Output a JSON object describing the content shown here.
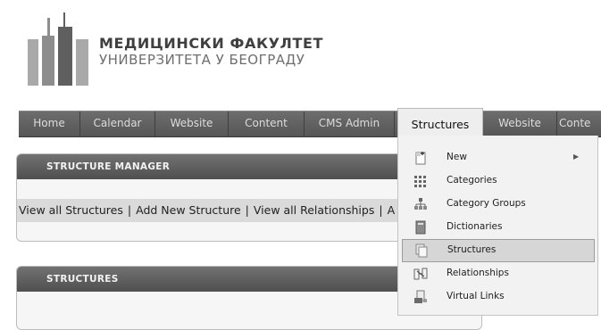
{
  "header": {
    "title_line1": "МЕДИЦИНСКИ ФАКУЛТЕТ",
    "title_line2": "УНИВЕРЗИТЕТА У БЕОГРАДУ",
    "logo_icon": "faculty-buildings-logo"
  },
  "nav": {
    "items": [
      {
        "label": "Home"
      },
      {
        "label": "Calendar"
      },
      {
        "label": "Website"
      },
      {
        "label": "Content"
      },
      {
        "label": "CMS Admin"
      },
      {
        "label": "Structures",
        "active": true
      },
      {
        "label": "Website"
      },
      {
        "label": "Conte"
      }
    ]
  },
  "structure_manager": {
    "title": "STRUCTURE MANAGER",
    "links": [
      "View all Structures",
      "Add New Structure",
      "View all Relationships",
      "A"
    ],
    "separator": "|"
  },
  "structures_panel": {
    "title": "STRUCTURES"
  },
  "dropdown": {
    "items": [
      {
        "label": "New",
        "icon": "new-page-icon",
        "has_submenu": true,
        "submenu_arrow": "▶"
      },
      {
        "label": "Categories",
        "icon": "grid-icon"
      },
      {
        "label": "Category Groups",
        "icon": "hierarchy-icon"
      },
      {
        "label": "Dictionaries",
        "icon": "book-icon"
      },
      {
        "label": "Structures",
        "icon": "pages-icon",
        "highlighted": true
      },
      {
        "label": "Relationships",
        "icon": "relationship-icon"
      },
      {
        "label": "Virtual Links",
        "icon": "virtual-link-icon"
      }
    ]
  },
  "colors": {
    "nav_background": "#606060",
    "active_tab_background": "#eeeeee",
    "panel_header": "#5e5e5e",
    "links_row": "#dadada",
    "dropdown_background": "#f2f2f2",
    "highlight": "#d6d6d6"
  }
}
